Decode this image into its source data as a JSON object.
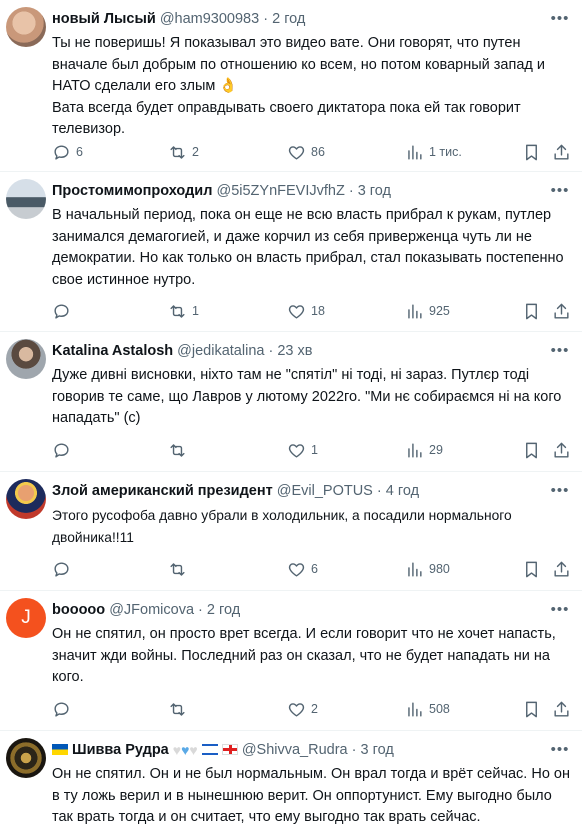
{
  "colors": {
    "muted": "#536471",
    "divider": "#eff3f4",
    "white_heart": "#e6e6e6",
    "blue_heart": "#5aa9e6"
  },
  "icons": {
    "reply": "reply-icon",
    "retweet": "retweet-icon",
    "like": "heart-icon",
    "views": "bar-chart-icon",
    "bookmark": "bookmark-icon",
    "share": "share-icon",
    "more": "more-icon"
  },
  "tweets": [
    {
      "name": "новый Лысый",
      "handle": "@ham9300983",
      "sep": "·",
      "time": "2 год",
      "text": "Ты не поверишь! Я показывал это видео вате. Они говорят, что путен вначале был добрым по отношению ко всем, но потом коварный запад и НАТО сделали его злым 👌\nВата всегда будет оправдывать своего диктатора пока ей так говорит телевизор.",
      "replies": "6",
      "retweets": "2",
      "likes": "86",
      "views": "1 тис."
    },
    {
      "name": "Простомимопроходил",
      "handle": "@5i5ZYnFEVIJvfhZ",
      "sep": "·",
      "time": "3 год",
      "text": "В начальный период, пока он еще не всю власть прибрал к рукам, путлер занимался демагогией, и даже корчил из себя приверженца чуть ли не демократии. Но как только он власть прибрал, стал показывать постепенно свое истинное нутро.",
      "replies": "",
      "retweets": "1",
      "likes": "18",
      "views": "925"
    },
    {
      "name": "Katalina Astalosh",
      "handle": "@jedikatalina",
      "sep": "·",
      "time": "23 хв",
      "text": "Дуже дивні висновки, ніхто там не \"спятіл\" ні тоді, ні зараз. Путлєр тоді говорив те саме, що Лавров у лютому 2022го. \"Ми нє собираємся ні на кого нападать\" (с)",
      "replies": "",
      "retweets": "",
      "likes": "1",
      "views": "29"
    },
    {
      "name": "Злой американский президент",
      "handle": "@Evil_POTUS",
      "sep": "·",
      "time": "4 год",
      "text": "Этого русофоба давно убрали в холодильник, а посадили нормального двойника!!11",
      "replies": "",
      "retweets": "",
      "likes": "6",
      "views": "980"
    },
    {
      "name": "booooo",
      "handle": "@JFomicova",
      "sep": "·",
      "time": "2 год",
      "avatar_letter": "J",
      "text": "Он не спятил, он просто врет всегда. И если говорит что не хочет напасть, значит жди войны. Последний раз он сказал, что не будет нападать ни на кого.",
      "replies": "",
      "retweets": "",
      "likes": "2",
      "views": "508"
    },
    {
      "name": "Шивва Рудра",
      "handle": "@Shivva_Rudra",
      "sep": "·",
      "time": "3 год",
      "text": "Он не спятил. Он и не был нормальным. Он врал тогда и врёт сейчас. Но он в ту ложь верил и в нынешнюю верит. Он оппортунист. Ему выгодно было так врать тогда и он считает, что ему выгодно так врать сейчас."
    }
  ]
}
